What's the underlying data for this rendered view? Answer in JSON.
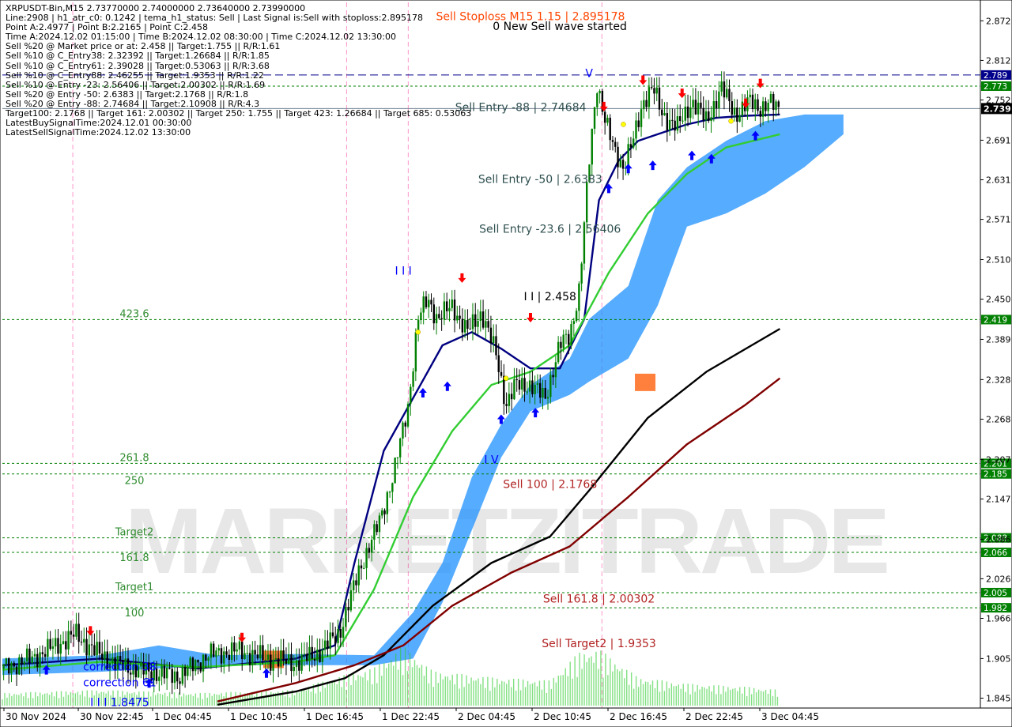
{
  "header_lines": [
    "XRPUSDT-Bin,M15  2.73770000 2.74000000 2.73640000 2.73990000",
    "Line:2908 | h1_atr_c0: 0.1242 | tema_h1_status: Sell | Last Signal is:Sell with stoploss:2.895178",
    "Point A:2.4977 | Point B:2.2165 | Point C:2.458",
    "Time A:2024.12.02 01:15:00 | Time B:2024.12.02 08:30:00 | Time C:2024.12.02 13:30:00",
    "Sell %20 @ Market price or at: 2.458 || Target:1.755 || R/R:1.61",
    "Sell %10 @ C_Entry38: 2.32392 || Target:1.26684 || R/R:1.85",
    "Sell %10 @ C_Entry61: 2.39028 || Target:0.53063 || R/R:3.68",
    "Sell %10 @ C_Entry88: 2.46255 || Target:1.9353 || R/R:1.22",
    "Sell %10 @ Entry -23: 2.56406 || Target:2.00302 || R/R:1.69",
    "Sell %20 @ Entry -50: 2.6383 || Target:2.1768 || R/R:1.8",
    "Sell %20 @ Entry -88: 2.74684 || Target:2.10908 || R/R:4.3",
    "Target100: 2.1768 || Target 161: 2.00302 || Target 250: 1.755 || Target 423: 1.26684 || Target 685: 0.53063",
    "LatestBuySignalTime:2024.12.01 00:30:00",
    "LatestSellSignalTime:2024.12.02 13:30:00"
  ],
  "watermark": "MARKETZITRADE",
  "colors": {
    "bull_candle": "#008000",
    "bear_candle": "#000000",
    "level_line": "#008000",
    "stop_line": "#00008b",
    "sell_text": "#b22222",
    "ichimoku_blue": "#1e90ff",
    "ichimoku_orange": "#ff6a1a",
    "ma_navy": "#000080",
    "ma_green": "#32cd32",
    "ma_black": "#000000",
    "ma_maroon": "#800000",
    "buy_arrow": "#0000ff",
    "sell_arrow": "#ff0000",
    "signal_star": "#ffff00",
    "volume": "#32cd32",
    "current_price_bg": "#000000"
  },
  "chart_data": {
    "type": "candlestick",
    "symbol": "XRPUSDT-Bin",
    "timeframe": "M15",
    "ylim": [
      1.83,
      2.9
    ],
    "y_ticks": [
      "2.872",
      "2.812",
      "2.752",
      "2.691",
      "2.631",
      "2.571",
      "2.510",
      "2.450",
      "2.389",
      "2.328",
      "2.268",
      "2.207",
      "2.147",
      "2.086",
      "2.026",
      "1.966",
      "1.905",
      "1.845"
    ],
    "x_ticks": [
      "30 Nov 2024",
      "30 Nov 22:45",
      "1 Dec 04:45",
      "1 Dec 10:45",
      "1 Dec 16:45",
      "1 Dec 22:45",
      "2 Dec 04:45",
      "2 Dec 10:45",
      "2 Dec 16:45",
      "2 Dec 22:45",
      "3 Dec 04:45"
    ],
    "current_price": "2.739",
    "levels": [
      {
        "price": 2.7899,
        "tag": "2.789",
        "style": "stop"
      },
      {
        "price": 2.773,
        "tag": "2.773",
        "style": "level"
      },
      {
        "price": 2.419,
        "tag": "2.419",
        "style": "level",
        "left_label": "423.6"
      },
      {
        "price": 2.201,
        "tag": "2.201",
        "style": "level",
        "left_label": "261.8"
      },
      {
        "price": 2.185,
        "tag": "2.185",
        "style": "level",
        "left_label": "250"
      },
      {
        "price": 2.088,
        "tag": "2.088",
        "style": "level",
        "left_label": "Target2"
      },
      {
        "price": 2.066,
        "tag": "2.066",
        "style": "level",
        "left_label": "161.8"
      },
      {
        "price": 2.005,
        "tag": "2.005",
        "style": "level",
        "left_label": "Target1"
      },
      {
        "price": 1.982,
        "tag": "1.982",
        "style": "level",
        "left_label": "100"
      }
    ],
    "annotations": [
      {
        "text": "Sell Stoploss M15 1.15 | 2.895178",
        "color": "#ff4500",
        "price": 2.873,
        "x_frac": 0.54
      },
      {
        "text": "0 New Sell wave started",
        "color": "#000000",
        "price": 2.858,
        "x_frac": 0.57
      },
      {
        "text": "Sell Entry -88 | 2.74684",
        "color": "#2f4f4f",
        "price": 2.735,
        "x_frac": 0.53
      },
      {
        "text": "Sell Entry -50 | 2.6383",
        "color": "#2f4f4f",
        "price": 2.626,
        "x_frac": 0.55
      },
      {
        "text": "Sell Entry -23.6 | 2.56406",
        "color": "#2f4f4f",
        "price": 2.551,
        "x_frac": 0.56
      },
      {
        "text": "I I | 2.458",
        "color": "#000000",
        "price": 2.448,
        "x_frac": 0.56
      },
      {
        "text": "Sell 100 | 2.1768",
        "color": "#b22222",
        "price": 2.164,
        "x_frac": 0.56
      },
      {
        "text": "Sell 161.8 | 2.00302",
        "color": "#b22222",
        "price": 1.99,
        "x_frac": 0.61
      },
      {
        "text": "Sell Target2 | 1.9353",
        "color": "#b22222",
        "price": 1.922,
        "x_frac": 0.61
      },
      {
        "text": "I I I",
        "color": "#0000ff",
        "price": 2.487,
        "x_frac": 0.41
      },
      {
        "text": "V",
        "color": "#0000ff",
        "price": 2.787,
        "x_frac": 0.6
      },
      {
        "text": "I V",
        "color": "#0000ff",
        "price": 2.201,
        "x_frac": 0.5
      },
      {
        "text": "I I I 1.8475",
        "color": "#0000ff",
        "price": 1.833,
        "x_frac": 0.12
      },
      {
        "text": "correction 38",
        "color": "#0000ff",
        "price": 1.887,
        "x_frac": 0.12
      },
      {
        "text": "correction 61",
        "color": "#0000ff",
        "price": 1.863,
        "x_frac": 0.12
      }
    ],
    "price_path": [
      [
        0.0,
        1.89
      ],
      [
        0.03,
        1.905
      ],
      [
        0.055,
        1.925
      ],
      [
        0.075,
        1.942
      ],
      [
        0.095,
        1.915
      ],
      [
        0.12,
        1.895
      ],
      [
        0.15,
        1.885
      ],
      [
        0.18,
        1.878
      ],
      [
        0.21,
        1.91
      ],
      [
        0.24,
        1.917
      ],
      [
        0.27,
        1.905
      ],
      [
        0.3,
        1.898
      ],
      [
        0.325,
        1.915
      ],
      [
        0.345,
        1.945
      ],
      [
        0.365,
        2.04
      ],
      [
        0.385,
        2.11
      ],
      [
        0.4,
        2.185
      ],
      [
        0.415,
        2.29
      ],
      [
        0.425,
        2.42
      ],
      [
        0.435,
        2.45
      ],
      [
        0.445,
        2.42
      ],
      [
        0.46,
        2.44
      ],
      [
        0.475,
        2.4
      ],
      [
        0.49,
        2.43
      ],
      [
        0.505,
        2.365
      ],
      [
        0.515,
        2.29
      ],
      [
        0.525,
        2.32
      ],
      [
        0.54,
        2.32
      ],
      [
        0.555,
        2.3
      ],
      [
        0.57,
        2.38
      ],
      [
        0.58,
        2.395
      ],
      [
        0.59,
        2.465
      ],
      [
        0.6,
        2.66
      ],
      [
        0.608,
        2.78
      ],
      [
        0.616,
        2.72
      ],
      [
        0.625,
        2.68
      ],
      [
        0.635,
        2.65
      ],
      [
        0.645,
        2.69
      ],
      [
        0.655,
        2.75
      ],
      [
        0.665,
        2.77
      ],
      [
        0.675,
        2.73
      ],
      [
        0.69,
        2.71
      ],
      [
        0.705,
        2.75
      ],
      [
        0.72,
        2.72
      ],
      [
        0.735,
        2.77
      ],
      [
        0.75,
        2.73
      ],
      [
        0.765,
        2.75
      ],
      [
        0.775,
        2.74
      ],
      [
        0.785,
        2.746
      ],
      [
        0.795,
        2.739
      ]
    ],
    "moving_averages": [
      {
        "color": "#000080",
        "points": [
          [
            0.0,
            1.895
          ],
          [
            0.1,
            1.905
          ],
          [
            0.2,
            1.89
          ],
          [
            0.3,
            1.905
          ],
          [
            0.34,
            1.925
          ],
          [
            0.36,
            2.05
          ],
          [
            0.39,
            2.22
          ],
          [
            0.42,
            2.3
          ],
          [
            0.45,
            2.38
          ],
          [
            0.48,
            2.4
          ],
          [
            0.51,
            2.375
          ],
          [
            0.54,
            2.345
          ],
          [
            0.57,
            2.345
          ],
          [
            0.595,
            2.42
          ],
          [
            0.61,
            2.6
          ],
          [
            0.63,
            2.66
          ],
          [
            0.65,
            2.69
          ],
          [
            0.67,
            2.7
          ],
          [
            0.7,
            2.715
          ],
          [
            0.73,
            2.725
          ],
          [
            0.76,
            2.728
          ],
          [
            0.795,
            2.73
          ]
        ]
      },
      {
        "color": "#32cd32",
        "points": [
          [
            0.0,
            1.888
          ],
          [
            0.1,
            1.9
          ],
          [
            0.2,
            1.892
          ],
          [
            0.3,
            1.9
          ],
          [
            0.34,
            1.91
          ],
          [
            0.38,
            2.01
          ],
          [
            0.42,
            2.15
          ],
          [
            0.46,
            2.25
          ],
          [
            0.5,
            2.32
          ],
          [
            0.54,
            2.34
          ],
          [
            0.58,
            2.38
          ],
          [
            0.62,
            2.49
          ],
          [
            0.66,
            2.58
          ],
          [
            0.7,
            2.64
          ],
          [
            0.74,
            2.68
          ],
          [
            0.795,
            2.7
          ]
        ]
      },
      {
        "color": "#000000",
        "points": [
          [
            0.22,
            1.835
          ],
          [
            0.3,
            1.855
          ],
          [
            0.35,
            1.875
          ],
          [
            0.39,
            1.91
          ],
          [
            0.44,
            1.985
          ],
          [
            0.5,
            2.05
          ],
          [
            0.56,
            2.09
          ],
          [
            0.6,
            2.16
          ],
          [
            0.66,
            2.27
          ],
          [
            0.72,
            2.34
          ],
          [
            0.795,
            2.405
          ]
        ]
      },
      {
        "color": "#800000",
        "points": [
          [
            0.22,
            1.84
          ],
          [
            0.3,
            1.868
          ],
          [
            0.36,
            1.895
          ],
          [
            0.41,
            1.925
          ],
          [
            0.46,
            1.985
          ],
          [
            0.52,
            2.035
          ],
          [
            0.58,
            2.075
          ],
          [
            0.64,
            2.15
          ],
          [
            0.7,
            2.23
          ],
          [
            0.76,
            2.29
          ],
          [
            0.795,
            2.33
          ]
        ]
      }
    ],
    "cloud_upper": [
      [
        0.0,
        1.905
      ],
      [
        0.1,
        1.91
      ],
      [
        0.16,
        1.925
      ],
      [
        0.22,
        1.91
      ],
      [
        0.3,
        1.912
      ],
      [
        0.38,
        1.91
      ],
      [
        0.42,
        1.975
      ],
      [
        0.45,
        2.05
      ],
      [
        0.48,
        2.18
      ],
      [
        0.51,
        2.26
      ],
      [
        0.54,
        2.32
      ],
      [
        0.58,
        2.36
      ],
      [
        0.6,
        2.42
      ],
      [
        0.64,
        2.47
      ],
      [
        0.67,
        2.6
      ],
      [
        0.7,
        2.65
      ],
      [
        0.74,
        2.69
      ],
      [
        0.78,
        2.72
      ],
      [
        0.82,
        2.73
      ],
      [
        0.86,
        2.73
      ]
    ],
    "cloud_lower": [
      [
        0.0,
        1.88
      ],
      [
        0.1,
        1.885
      ],
      [
        0.16,
        1.89
      ],
      [
        0.22,
        1.895
      ],
      [
        0.3,
        1.895
      ],
      [
        0.38,
        1.895
      ],
      [
        0.42,
        1.905
      ],
      [
        0.45,
        1.99
      ],
      [
        0.48,
        2.1
      ],
      [
        0.51,
        2.21
      ],
      [
        0.54,
        2.28
      ],
      [
        0.58,
        2.305
      ],
      [
        0.6,
        2.325
      ],
      [
        0.64,
        2.36
      ],
      [
        0.67,
        2.44
      ],
      [
        0.7,
        2.56
      ],
      [
        0.74,
        2.58
      ],
      [
        0.78,
        2.61
      ],
      [
        0.82,
        2.65
      ],
      [
        0.86,
        2.7
      ]
    ],
    "buy_signals": [
      [
        0.045,
        1.9
      ],
      [
        0.15,
        1.88
      ],
      [
        0.27,
        1.895
      ],
      [
        0.43,
        2.32
      ],
      [
        0.455,
        2.33
      ],
      [
        0.51,
        2.28
      ],
      [
        0.545,
        2.29
      ],
      [
        0.62,
        2.63
      ],
      [
        0.64,
        2.66
      ],
      [
        0.665,
        2.665
      ],
      [
        0.705,
        2.68
      ],
      [
        0.725,
        2.675
      ],
      [
        0.77,
        2.71
      ]
    ],
    "sell_signals": [
      [
        0.09,
        1.935
      ],
      [
        0.245,
        1.925
      ],
      [
        0.47,
        2.47
      ],
      [
        0.54,
        2.41
      ],
      [
        0.615,
        2.73
      ],
      [
        0.655,
        2.77
      ],
      [
        0.695,
        2.75
      ],
      [
        0.76,
        2.735
      ],
      [
        0.775,
        2.765
      ]
    ],
    "volume_path": [
      [
        0.0,
        0.2
      ],
      [
        0.1,
        0.25
      ],
      [
        0.2,
        0.2
      ],
      [
        0.3,
        0.25
      ],
      [
        0.34,
        0.45
      ],
      [
        0.38,
        0.6
      ],
      [
        0.41,
        0.95
      ],
      [
        0.44,
        0.55
      ],
      [
        0.5,
        0.45
      ],
      [
        0.56,
        0.4
      ],
      [
        0.59,
        0.85
      ],
      [
        0.61,
        0.9
      ],
      [
        0.65,
        0.45
      ],
      [
        0.7,
        0.35
      ],
      [
        0.76,
        0.3
      ],
      [
        0.795,
        0.25
      ]
    ]
  }
}
